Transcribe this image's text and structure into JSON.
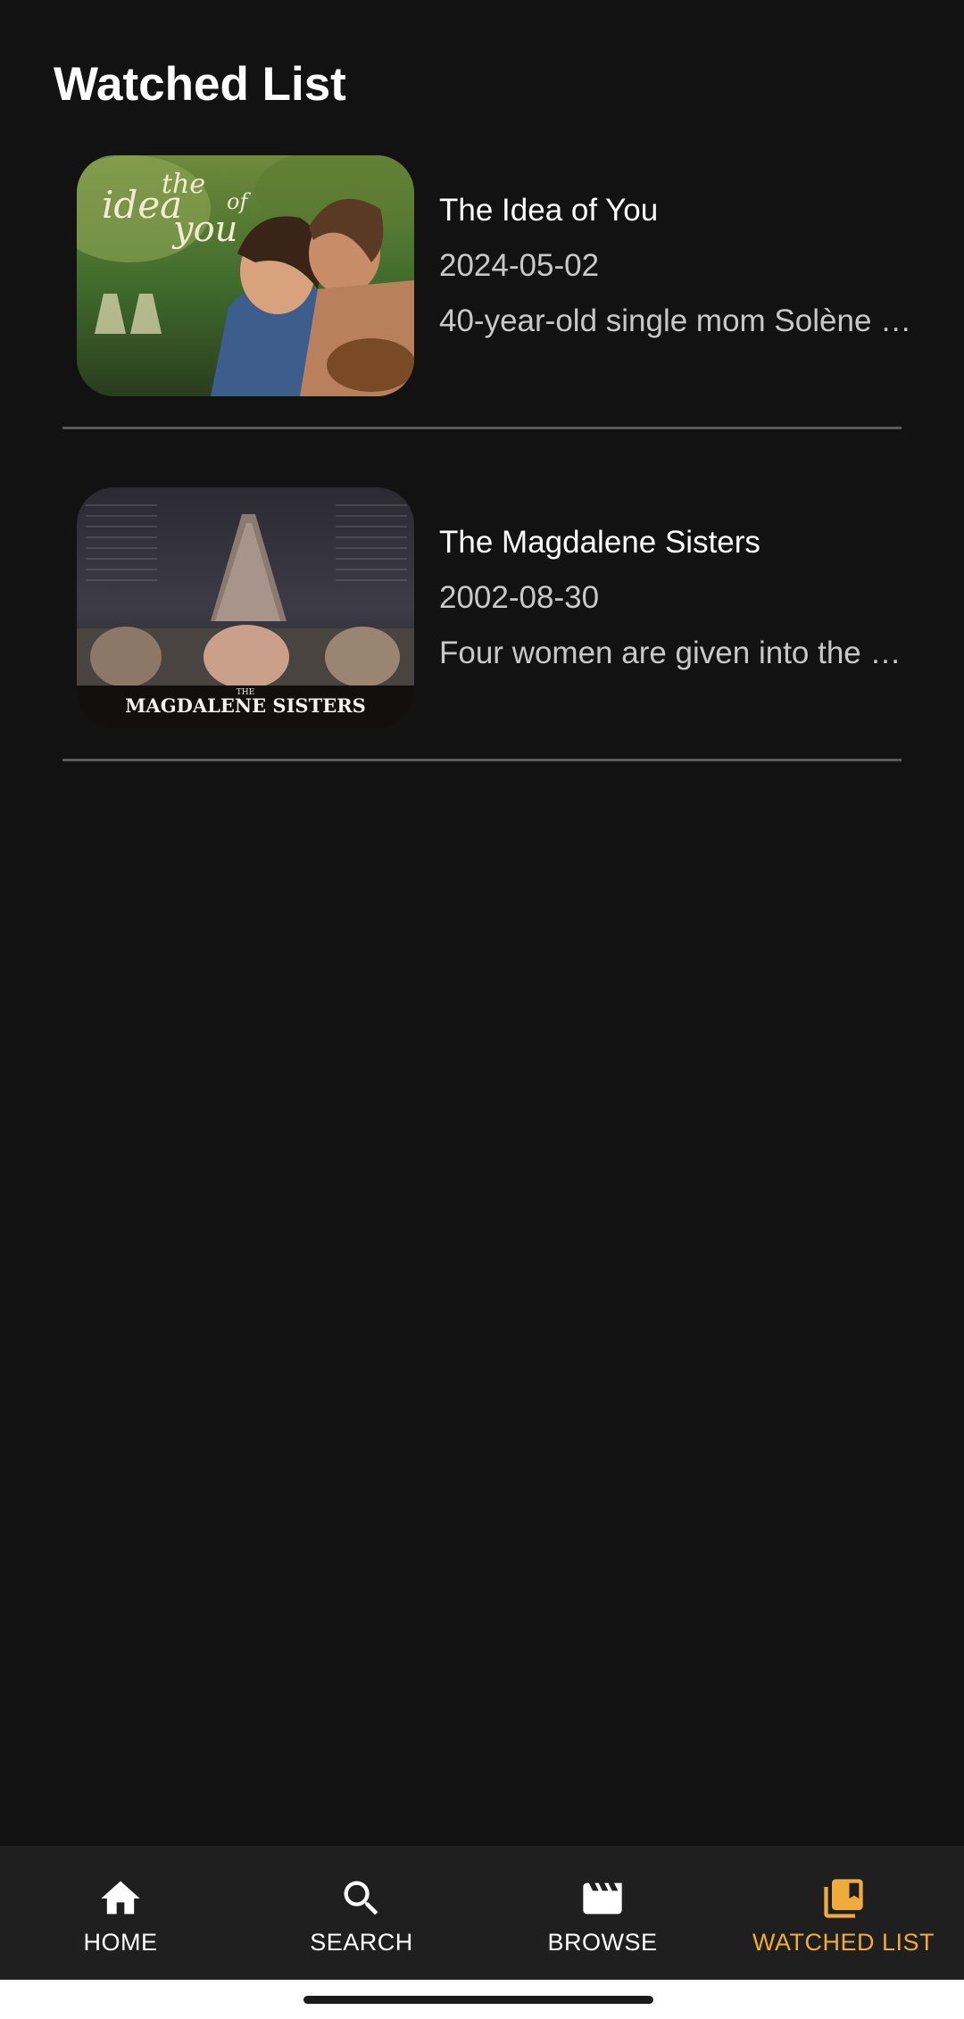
{
  "header": {
    "title": "Watched List"
  },
  "movies": [
    {
      "title": "The Idea of You",
      "release_date": "2024-05-02",
      "overview": "40-year-old single mom Solène …",
      "poster_text": [
        "the",
        "idea",
        "of",
        "you"
      ]
    },
    {
      "title": "The Magdalene Sisters",
      "release_date": "2002-08-30",
      "overview": "Four women are given into the …",
      "poster_text": [
        "THE",
        "MAGDALENE SISTERS"
      ]
    }
  ],
  "bottom_nav": {
    "items": [
      {
        "label": "HOME",
        "icon": "home-icon"
      },
      {
        "label": "SEARCH",
        "icon": "search-icon"
      },
      {
        "label": "BROWSE",
        "icon": "clapperboard-icon"
      },
      {
        "label": "WATCHED LIST",
        "icon": "video-library-icon"
      }
    ],
    "active_index": 3
  },
  "colors": {
    "background": "#121212",
    "nav_background": "#1f1f1f",
    "accent": "#f0ac3a",
    "divider": "#5a5a5a"
  }
}
